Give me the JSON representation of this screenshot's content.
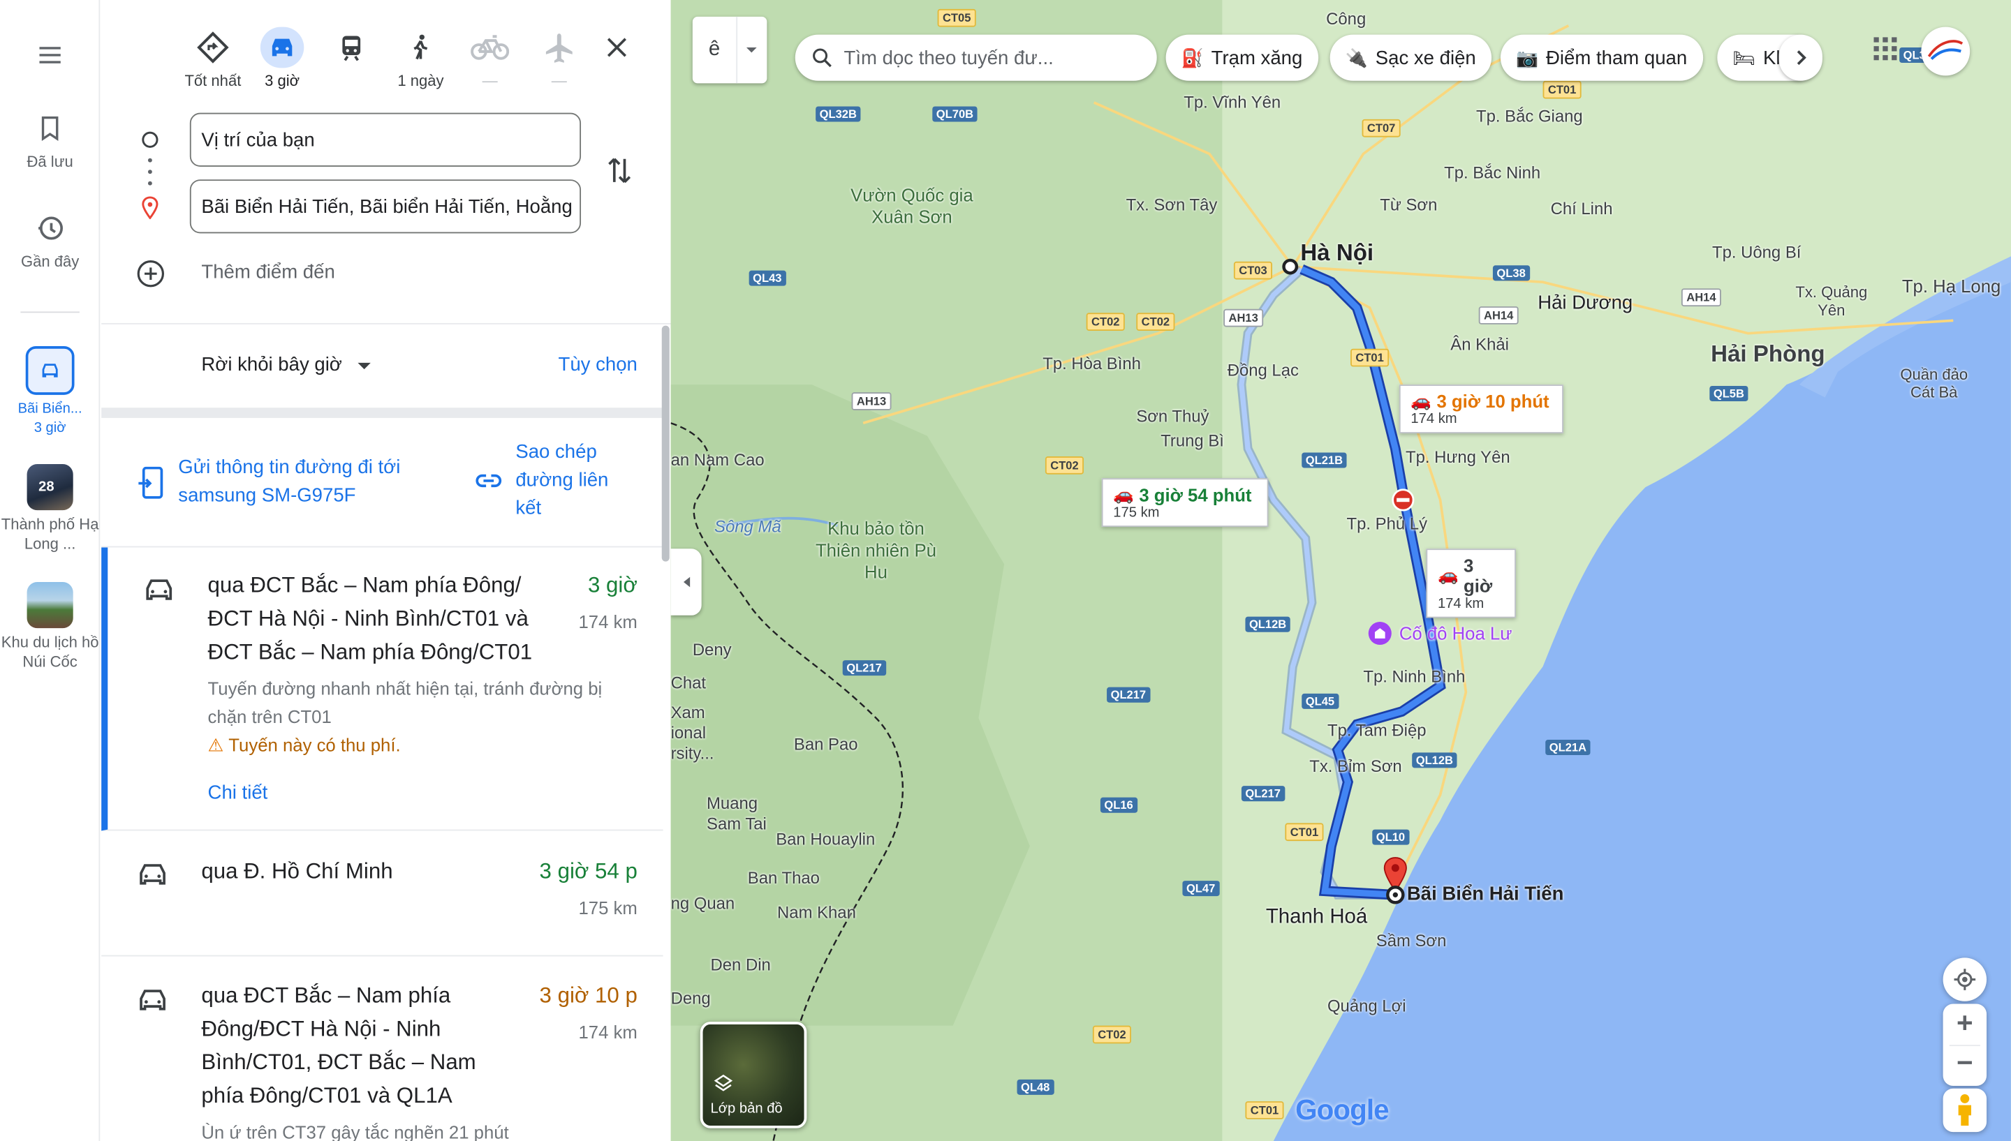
{
  "rail": {
    "saved_label": "Đã lưu",
    "recent_label": "Gần đây",
    "history_item": {
      "label": "Bãi Biển...",
      "sub": "3 giờ"
    },
    "places": [
      {
        "label": "Thành phố Hạ Long ...",
        "badge": "28"
      },
      {
        "label": "Khu du lịch hồ Núi Cốc"
      }
    ]
  },
  "modes": [
    {
      "name": "best",
      "label": "Tốt nhất"
    },
    {
      "name": "car",
      "label": "3 giờ",
      "selected": true
    },
    {
      "name": "transit",
      "label": ""
    },
    {
      "name": "walk",
      "label": "1 ngày"
    },
    {
      "name": "bike",
      "label": "—"
    },
    {
      "name": "flight",
      "label": "—"
    }
  ],
  "origin": {
    "value": "Vị trí của bạn"
  },
  "destination": {
    "value": "Bãi Biển Hải Tiến, Bãi biển Hải Tiến, Hoằng"
  },
  "add_stop": "Thêm điểm đến",
  "depart": {
    "label": "Rời khỏi bây giờ",
    "options": "Tùy chọn"
  },
  "send": {
    "label": "Gửi thông tin đường đi tới samsung SM-G975F",
    "copy": "Sao chép đường liên kết"
  },
  "routes": [
    {
      "title": "qua ĐCT Bắc – Nam phía Đông/ ĐCT Hà Nội - Ninh Bình/CT01 và ĐCT Bắc – Nam phía Đông/CT01",
      "time": "3 giờ",
      "distance": "174 km",
      "desc": "Tuyến đường nhanh nhất hiện tại, tránh đường bị chặn trên CT01",
      "warning": "Tuyến này có thu phí.",
      "details": "Chi tiết",
      "time_color": "#188038"
    },
    {
      "title": "qua Đ. Hồ Chí Minh",
      "time": "3 giờ 54 p",
      "distance": "175 km",
      "time_color": "#188038"
    },
    {
      "title": "qua ĐCT Bắc – Nam phía Đông/ĐCT Hà Nội - Ninh Bình/CT01, ĐCT Bắc – Nam phía Đông/CT01 và QL1A",
      "time": "3 giờ 10 p",
      "distance": "174 km",
      "desc": "Ùn ứ trên CT37 gây tắc nghẽn 21 phút",
      "time_color": "#b06000"
    }
  ],
  "map": {
    "search_placeholder": "Tìm dọc theo tuyến đư...",
    "chips": [
      "Trạm xăng",
      "Sạc xe điện",
      "Điểm tham quan",
      "Kh"
    ],
    "layer_label": "Lớp bản đồ",
    "badge_text": "ê",
    "google": "Google",
    "bubbles": [
      {
        "time": "3 giờ 10 phút",
        "dist": "174 km",
        "color": "#e37400"
      },
      {
        "time": "3 giờ 54 phút",
        "dist": "175 km",
        "color": "#188038"
      },
      {
        "time": "3 giờ",
        "dist": "174 km",
        "color": "#202124"
      }
    ],
    "places": [
      "Hà Nội",
      "Hải Phòng",
      "Hải Dương",
      "Thanh Hoá",
      "Bãi Biển Hải Tiến",
      "Tp. Vĩnh Yên",
      "Tp. Bắc Giang",
      "Tp. Bắc Ninh",
      "Từ Sơn",
      "Chí Linh",
      "Tx. Sơn Tây",
      "Vườn Quốc gia Xuân Sơn",
      "Tp. Hòa Bình",
      "Đồng Lạc",
      "Sơn Thuỷ",
      "Trung Bì",
      "Tp. Hưng Yên",
      "Tp. Phủ Lý",
      "Khu bảo tồn Thiên nhiên Pù Hu",
      "Cố đô Hoa Lư",
      "Tp. Ninh Bình",
      "Tp. Tam Điệp",
      "Tx. Bỉm Sơn",
      "Sầm Sơn",
      "Quảng Lợi",
      "Ban Pao",
      "Muang Sam Tai",
      "Ban Houaylin",
      "Ban Thao",
      "Nam Khan",
      "Den Din",
      "Deny",
      "Deng",
      "ng Quan",
      "Ân Khải",
      "Tp. Uông Bí",
      "Tx. Quảng Yên",
      "Tp. Hạ Long",
      "Quần đảo Cát Bà",
      "Công",
      "an Nam Cao",
      "Sông Mã",
      "Chat",
      "Xam ional rsity..."
    ],
    "roads": [
      "CT05",
      "CT01",
      "CT07",
      "QL32B",
      "QL70B",
      "QL43",
      "CT03",
      "CT02",
      "AH13",
      "QL38",
      "AH14",
      "AH14",
      "CT01",
      "QL5B",
      "CT02",
      "CT02",
      "AH13",
      "QL21B",
      "QL12B",
      "QL217",
      "QL217",
      "QL45",
      "QL12B",
      "QL21A",
      "QL217",
      "QL16",
      "CT01",
      "QL10",
      "QL47",
      "CT02",
      "QL48",
      "CT01",
      "QL3"
    ]
  }
}
